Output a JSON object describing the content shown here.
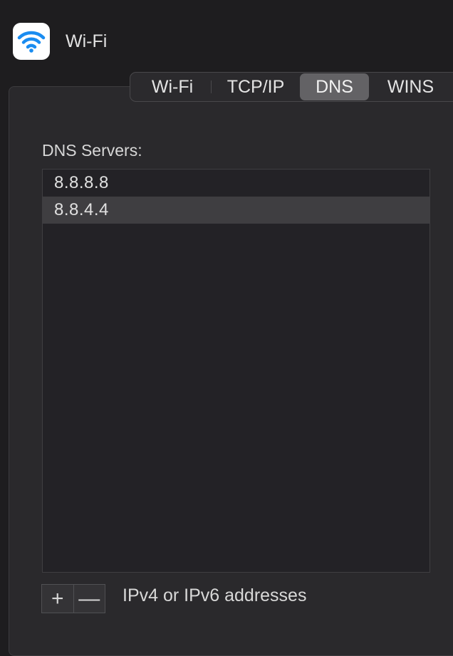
{
  "header": {
    "title": "Wi-Fi",
    "icon": "wifi-icon",
    "icon_color": "#1a8cf0"
  },
  "tabs": [
    {
      "label": "Wi-Fi",
      "selected": false
    },
    {
      "label": "TCP/IP",
      "selected": false
    },
    {
      "label": "DNS",
      "selected": true
    },
    {
      "label": "WINS",
      "selected": false
    }
  ],
  "dns": {
    "label": "DNS Servers:",
    "servers": [
      "8.8.8.8",
      "8.8.4.4"
    ],
    "selected_index": 1,
    "add_label": "+",
    "remove_label": "—",
    "hint": "IPv4 or IPv6 addresses"
  }
}
